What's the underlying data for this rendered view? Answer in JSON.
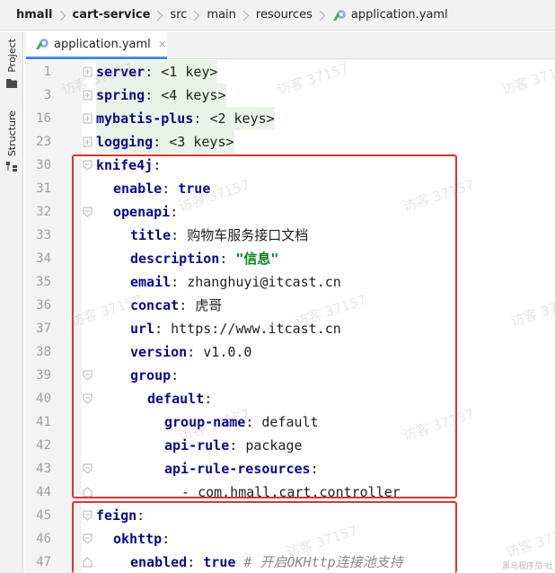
{
  "breadcrumb": {
    "items": [
      "hmall",
      "cart-service",
      "src",
      "main",
      "resources",
      "application.yaml"
    ]
  },
  "toolstrip": {
    "project_label": "Project",
    "structure_label": "Structure"
  },
  "tab": {
    "label": "application.yaml",
    "close_glyph": "×"
  },
  "editor": {
    "lines": [
      {
        "num": "1",
        "key": "server",
        "sep": ": ",
        "rest": "<1 key>"
      },
      {
        "num": "3",
        "key": "spring",
        "sep": ": ",
        "rest": "<4 keys>"
      },
      {
        "num": "16",
        "key": "mybatis-plus",
        "sep": ": ",
        "rest": "<2 keys>"
      },
      {
        "num": "23",
        "key": "logging",
        "sep": ": ",
        "rest": "<3 keys>"
      },
      {
        "num": "30",
        "key": "knife4j",
        "sep": ":",
        "rest": ""
      },
      {
        "num": "31",
        "key": "enable",
        "sep": ": ",
        "rest": "true"
      },
      {
        "num": "32",
        "key": "openapi",
        "sep": ":",
        "rest": ""
      },
      {
        "num": "33",
        "key": "title",
        "sep": ": ",
        "rest": "购物车服务接口文档"
      },
      {
        "num": "34",
        "key": "description",
        "sep": ": ",
        "rest": "\"信息\""
      },
      {
        "num": "35",
        "key": "email",
        "sep": ": ",
        "rest": "zhanghuyi@itcast.cn"
      },
      {
        "num": "36",
        "key": "concat",
        "sep": ": ",
        "rest": "虎哥"
      },
      {
        "num": "37",
        "key": "url",
        "sep": ": ",
        "rest": "https://www.itcast.cn"
      },
      {
        "num": "38",
        "key": "version",
        "sep": ": ",
        "rest": "v1.0.0"
      },
      {
        "num": "39",
        "key": "group",
        "sep": ":",
        "rest": ""
      },
      {
        "num": "40",
        "key": "default",
        "sep": ":",
        "rest": ""
      },
      {
        "num": "41",
        "key": "group-name",
        "sep": ": ",
        "rest": "default"
      },
      {
        "num": "42",
        "key": "api-rule",
        "sep": ": ",
        "rest": "package"
      },
      {
        "num": "43",
        "key": "api-rule-resources",
        "sep": ":",
        "rest": ""
      },
      {
        "num": "44",
        "key": "",
        "sep": "- ",
        "rest": "com.hmall.cart.controller"
      },
      {
        "num": "45",
        "key": "feign",
        "sep": ":",
        "rest": ""
      },
      {
        "num": "46",
        "key": "okhttp",
        "sep": ":",
        "rest": ""
      },
      {
        "num": "47",
        "key": "enabled",
        "sep": ": ",
        "rest": "true",
        "comment": "# 开启OKHttp连接池支持"
      }
    ]
  },
  "watermark": {
    "text": "访客 37157",
    "corner": "黑马程序员·社"
  },
  "colors": {
    "highlight": "#e03030",
    "key": "#0a0a8a",
    "string": "#127e1f",
    "folded_bg": "#eaf3e7"
  }
}
